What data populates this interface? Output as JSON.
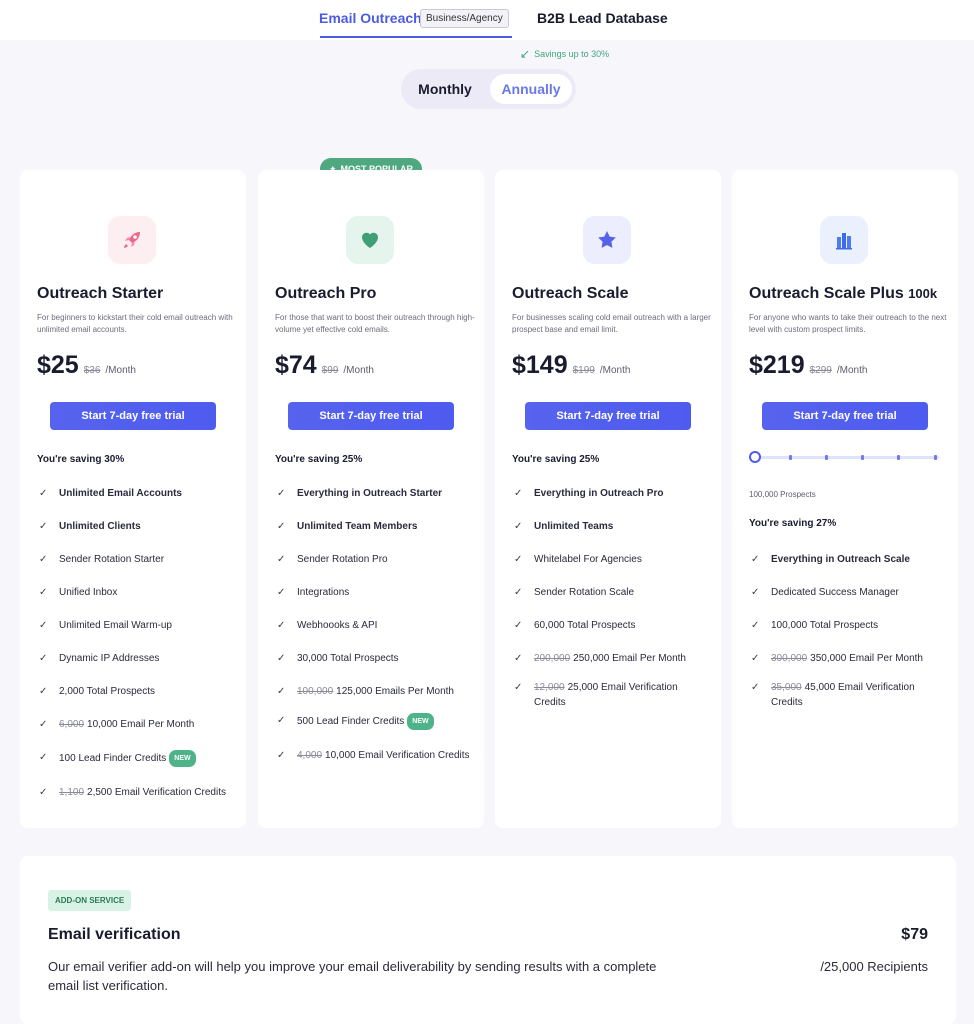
{
  "tabs": {
    "email_outreach": "Email Outreach",
    "badge": "Business/Agency",
    "b2b": "B2B Lead Database"
  },
  "savings_note": "Savings up to 30%",
  "billing_toggle": {
    "monthly": "Monthly",
    "annually": "Annually",
    "selected": "Annually"
  },
  "popular_badge": "MOST POPULAR",
  "colors": {
    "accent": "#4b5be3",
    "green": "#4fa880"
  },
  "plans": [
    {
      "icon": "rocket-icon",
      "name": "Outreach Starter",
      "desc": "For beginners to kickstart their cold email outreach with unlimited email accounts.",
      "price": "$25",
      "old_price": "$36",
      "per": "/Month",
      "cta": "Start 7-day free trial",
      "saving": "You're saving 30%",
      "features": [
        {
          "text": "Unlimited Email Accounts"
        },
        {
          "text": "Unlimited Clients"
        },
        {
          "text": "Sender Rotation Starter"
        },
        {
          "text": "Unified Inbox"
        },
        {
          "text": "Unlimited Email Warm-up"
        },
        {
          "text": "Dynamic IP Addresses"
        },
        {
          "text": "2,000 Total Prospects"
        },
        {
          "strike": "6,000",
          "text": "10,000 Email Per Month"
        },
        {
          "text": "100 Lead Finder Credits",
          "badge": "NEW"
        },
        {
          "strike": "1,100",
          "text": "2,500 Email Verification Credits"
        }
      ]
    },
    {
      "icon": "heart-icon",
      "name": "Outreach Pro",
      "desc": "For those that want to boost their outreach through high-volume yet effective cold emails.",
      "price": "$74",
      "old_price": "$99",
      "per": "/Month",
      "cta": "Start 7-day free trial",
      "saving": "You're saving 25%",
      "features": [
        {
          "text": "Everything in Outreach Starter"
        },
        {
          "text": "Unlimited Team Members"
        },
        {
          "text": "Sender Rotation Pro"
        },
        {
          "text": "Integrations"
        },
        {
          "text": "Webhoooks & API"
        },
        {
          "text": "30,000 Total Prospects"
        },
        {
          "strike": "100,000",
          "text": "125,000 Emails Per Month"
        },
        {
          "text": "500 Lead Finder Credits",
          "badge": "NEW"
        },
        {
          "strike": "4,000",
          "text": "10,000 Email Verification Credits"
        }
      ]
    },
    {
      "icon": "star-icon",
      "name": "Outreach Scale",
      "desc": "For businesses scaling cold email outreach with a larger prospect base and email limit.",
      "price": "$149",
      "old_price": "$199",
      "per": "/Month",
      "cta": "Start 7-day free trial",
      "saving": "You're saving 25%",
      "features": [
        {
          "text": "Everything in Outreach Pro"
        },
        {
          "text": "Unlimited Teams"
        },
        {
          "text": "Whitelabel For Agencies"
        },
        {
          "text": "Sender Rotation Scale"
        },
        {
          "text": "60,000 Total Prospects"
        },
        {
          "strike": "200,000",
          "text": "250,000 Email Per Month"
        },
        {
          "strike": "12,000",
          "text": "25,000 Email Verification Credits"
        }
      ]
    },
    {
      "icon": "building-icon",
      "name": "Outreach Scale Plus",
      "name_suffix": "100k",
      "desc": "For anyone who wants to take their outreach to the next level with custom prospect limits.",
      "price": "$219",
      "old_price": "$299",
      "per": "/Month",
      "cta": "Start 7-day free trial",
      "prospects": "100,000 Prospects",
      "slider_level": 0,
      "saving": "You're saving 27%",
      "features": [
        {
          "text": "Everything in Outreach Scale"
        },
        {
          "text": "Dedicated Success Manager"
        },
        {
          "text": "100,000 Total Prospects"
        },
        {
          "strike": "300,000",
          "text": "350,000 Email Per Month"
        },
        {
          "strike": "35,000",
          "text": "45,000 Email Verification Credits"
        }
      ]
    }
  ],
  "addon": {
    "tag": "ADD-ON SERVICE",
    "title": "Email verification",
    "desc": "Our email verifier add-on will help you improve your email deliverability by sending results with a complete email list verification.",
    "price": "$79",
    "unit": "/25,000 Recipients"
  }
}
